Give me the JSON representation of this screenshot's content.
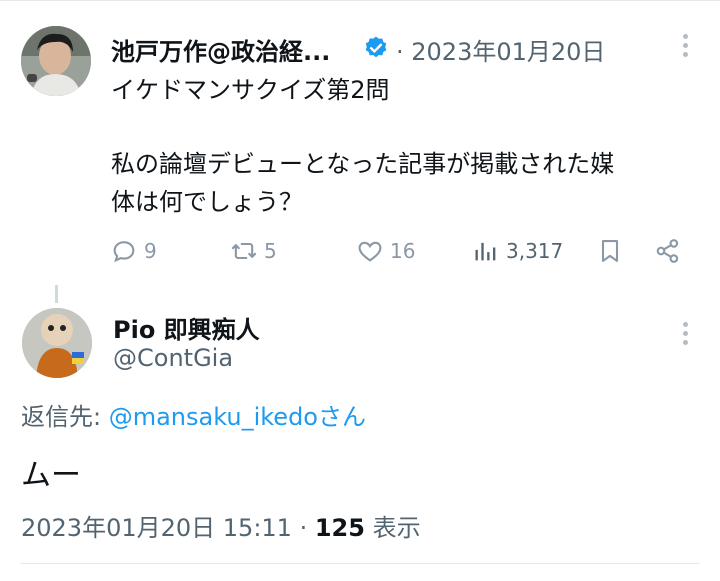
{
  "tweet": {
    "author_name": "池戸万作@政治経...",
    "date": "· 2023年01月20日",
    "line1": "イケドマンサクイズ第2問",
    "line2": "私の論壇デビューとなった記事が掲載された媒",
    "line3": "体は何でしょう？",
    "replies": "9",
    "retweets": "5",
    "likes": "16",
    "views": "3,317"
  },
  "reply": {
    "author_name": "Pio 即興痴人",
    "handle": "@ContGia",
    "reply_to_label": "返信先: ",
    "reply_to_handle": "@mansaku_ikedo",
    "reply_to_suffix": "さん",
    "body": "ムー",
    "timestamp": "2023年01月20日 15:11 · ",
    "view_count": "125",
    "view_label": " 表示"
  },
  "colors": {
    "link": "#1d9bf0",
    "verified": "#1d9bf0",
    "muted": "#8b98a5"
  }
}
